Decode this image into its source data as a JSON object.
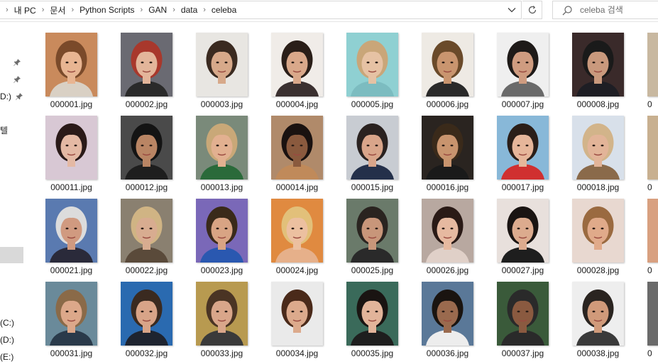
{
  "address": {
    "crumbs": [
      "내 PC",
      "문서",
      "Python Scripts",
      "GAN",
      "data",
      "celeba"
    ]
  },
  "search": {
    "placeholder": "celeba 검색"
  },
  "nav": {
    "items": [
      {
        "label": "",
        "pinned": true
      },
      {
        "label": "",
        "pinned": true
      },
      {
        "label": "D:)",
        "pinned": true
      },
      {
        "label": "텔",
        "pinned": false
      },
      {
        "label": "",
        "pinned": false,
        "selected": true
      },
      {
        "label": "(C:)",
        "pinned": false
      },
      {
        "label": "(D:)",
        "pinned": false
      },
      {
        "label": "(E:)",
        "pinned": false
      }
    ]
  },
  "files": [
    {
      "name": "000001.jpg",
      "bg": "#c98a5c",
      "skin": "#e8b592",
      "hair": "#7a4a2a",
      "cloth": "#d9d0c4"
    },
    {
      "name": "000002.jpg",
      "bg": "#6a6a72",
      "skin": "#e3b59a",
      "hair": "#a8382c",
      "cloth": "#2a2a2a"
    },
    {
      "name": "000003.jpg",
      "bg": "#e8e6e2",
      "skin": "#d7a98a",
      "hair": "#3a2a20",
      "cloth": "#e8e6e2"
    },
    {
      "name": "000004.jpg",
      "bg": "#f0ece8",
      "skin": "#d9a88a",
      "hair": "#2a1e18",
      "cloth": "#3a3030"
    },
    {
      "name": "000005.jpg",
      "bg": "#8fd0d2",
      "skin": "#e6c2a4",
      "hair": "#c9a679",
      "cloth": "#7cbcc0"
    },
    {
      "name": "000006.jpg",
      "bg": "#eeeae4",
      "skin": "#c9956f",
      "hair": "#6a4a2a",
      "cloth": "#2a2a2a"
    },
    {
      "name": "000007.jpg",
      "bg": "#efefef",
      "skin": "#cf9c80",
      "hair": "#1e1a18",
      "cloth": "#6a6a6a"
    },
    {
      "name": "000008.jpg",
      "bg": "#3a2a2a",
      "skin": "#c9997d",
      "hair": "#1a1a1a",
      "cloth": "#1e1e24"
    },
    {
      "name": "000011.jpg",
      "bg": "#d8c8d4",
      "skin": "#e4b9a4",
      "hair": "#2a1a18",
      "cloth": "#d8c8d4"
    },
    {
      "name": "000012.jpg",
      "bg": "#4a4a4a",
      "skin": "#b98564",
      "hair": "#141414",
      "cloth": "#1e1e1e"
    },
    {
      "name": "000013.jpg",
      "bg": "#7a8a7a",
      "skin": "#e2b090",
      "hair": "#c9a878",
      "cloth": "#2a6a3a"
    },
    {
      "name": "000014.jpg",
      "bg": "#b08a6a",
      "skin": "#8a5a3e",
      "hair": "#1a1210",
      "cloth": "#c08a5a"
    },
    {
      "name": "000015.jpg",
      "bg": "#c8ccd2",
      "skin": "#d9a58a",
      "hair": "#2a2220",
      "cloth": "#24304a"
    },
    {
      "name": "000016.jpg",
      "bg": "#2a2420",
      "skin": "#c8946e",
      "hair": "#3a2a1a",
      "cloth": "#1a1a1a"
    },
    {
      "name": "000017.jpg",
      "bg": "#88b8d8",
      "skin": "#e6b69a",
      "hair": "#2a1e18",
      "cloth": "#d03030"
    },
    {
      "name": "000018.jpg",
      "bg": "#d8e0ea",
      "skin": "#e2b498",
      "hair": "#d2b48a",
      "cloth": "#8a6a4a"
    },
    {
      "name": "000021.jpg",
      "bg": "#5a7ab0",
      "skin": "#d09a80",
      "hair": "#dcdcdc",
      "cloth": "#2a2a3a"
    },
    {
      "name": "000022.jpg",
      "bg": "#8a8070",
      "skin": "#d8ac90",
      "hair": "#d0b484",
      "cloth": "#5a4a3a"
    },
    {
      "name": "000023.jpg",
      "bg": "#7a68b8",
      "skin": "#d8a484",
      "hair": "#3a2a1a",
      "cloth": "#2a58b0"
    },
    {
      "name": "000024.jpg",
      "bg": "#e08a40",
      "skin": "#ecc0a0",
      "hair": "#e2c07a",
      "cloth": "#e6b08a"
    },
    {
      "name": "000025.jpg",
      "bg": "#6a7a6a",
      "skin": "#c8967a",
      "hair": "#2a2420",
      "cloth": "#2a2a2a"
    },
    {
      "name": "000026.jpg",
      "bg": "#b8a8a0",
      "skin": "#e6b9a0",
      "hair": "#2a1a16",
      "cloth": "#e0d0c8"
    },
    {
      "name": "000027.jpg",
      "bg": "#e8e0dc",
      "skin": "#dcab8e",
      "hair": "#1a1412",
      "cloth": "#1e1e1e"
    },
    {
      "name": "000028.jpg",
      "bg": "#e8d8d0",
      "skin": "#e0aa8a",
      "hair": "#9a6a40",
      "cloth": "#e8d8d0"
    },
    {
      "name": "000031.jpg",
      "bg": "#6a8a9a",
      "skin": "#dca88a",
      "hair": "#8a6a48",
      "cloth": "#2a3a4a"
    },
    {
      "name": "000032.jpg",
      "bg": "#2a6ab0",
      "skin": "#d8a488",
      "hair": "#3a2a20",
      "cloth": "#1e2430"
    },
    {
      "name": "000033.jpg",
      "bg": "#b89a50",
      "skin": "#d9a68a",
      "hair": "#4a3424",
      "cloth": "#3a3a3a"
    },
    {
      "name": "000034.jpg",
      "bg": "#eaeaea",
      "skin": "#dcaa8c",
      "hair": "#4a2a1a",
      "cloth": "#eaeaea"
    },
    {
      "name": "000035.jpg",
      "bg": "#3a6a5a",
      "skin": "#e2b49a",
      "hair": "#1a1412",
      "cloth": "#1e1e1e"
    },
    {
      "name": "000036.jpg",
      "bg": "#5a7898",
      "skin": "#9a6a4e",
      "hair": "#1a1410",
      "cloth": "#ededed"
    },
    {
      "name": "000037.jpg",
      "bg": "#3a5a3a",
      "skin": "#8a5a40",
      "hair": "#2a2a2a",
      "cloth": "#2a2a2a"
    },
    {
      "name": "000038.jpg",
      "bg": "#eeeeee",
      "skin": "#d09a7a",
      "hair": "#2a2420",
      "cloth": "#3a3a3a"
    }
  ],
  "partial_column": [
    {
      "name": "0",
      "bg": "#c8b8a0"
    },
    {
      "name": "0",
      "bg": "#c8b090"
    },
    {
      "name": "0",
      "bg": "#d8a080"
    },
    {
      "name": "0",
      "bg": "#6a6a6a"
    }
  ]
}
